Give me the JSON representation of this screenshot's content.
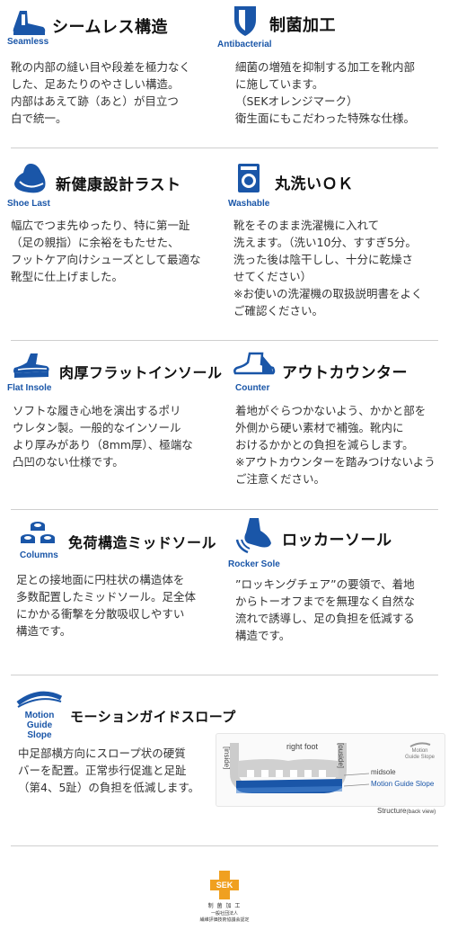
{
  "features": [
    {
      "id": "seamless",
      "title": "シームレス構造",
      "subtitle": "Seamless",
      "icon": "shoe-icon",
      "body": "靴の内部の縫い目や段差を極力なく\nした、足あたりのやさしい構造。\n内部はあえて跡（あと）が目立つ\n白で統一。"
    },
    {
      "id": "antibacterial",
      "title": "制菌加工",
      "subtitle": "Antibacterial",
      "icon": "shield-icon",
      "body": "細菌の増殖を抑制する加工を靴内部\nに施しています。\n（SEKオレンジマーク）\n衛生面にもこだわった特殊な仕様。"
    },
    {
      "id": "shoe-last",
      "title": "新健康設計ラスト",
      "subtitle": "Shoe Last",
      "icon": "shoe-last-icon",
      "body": "幅広でつま先ゆったり、特に第一趾\n（足の親指）に余裕をもたせた、\nフットケア向けシューズとして最適な\n靴型に仕上げました。"
    },
    {
      "id": "washable",
      "title": "丸洗いＯＫ",
      "subtitle": "Washable",
      "icon": "washing-machine-icon",
      "body": "靴をそのまま洗濯機に入れて\n洗えます。（洗い10分、すすぎ5分。\n洗った後は陰干しし、十分に乾燥さ\nせてください）\n※お使いの洗濯機の取扱説明書をよく\nご確認ください。"
    },
    {
      "id": "flat-insole",
      "title": "肉厚フラットインソール",
      "subtitle": "Flat Insole",
      "icon": "insole-icon",
      "body": "ソフトな履き心地を演出するポリ\nウレタン製。一般的なインソール\nより厚みがあり（8mm厚）、極端な\n凸凹のない仕様です。"
    },
    {
      "id": "counter",
      "title": "アウトカウンター",
      "subtitle": "Counter",
      "icon": "counter-icon",
      "body": "着地がぐらつかないよう、かかと部を\n外側から硬い素材で補強。靴内に\nおけるかかとの負担を減らします。\n※アウトカウンターを踏みつけないよう\nご注意ください。"
    },
    {
      "id": "columns",
      "title": "免荷構造ミッドソール",
      "subtitle": "Columns",
      "icon": "columns-icon",
      "body": "足との接地面に円柱状の構造体を\n多数配置したミッドソール。足全体\nにかかる衝撃を分散吸収しやすい\n構造です。"
    },
    {
      "id": "rocker-sole",
      "title": "ロッカーソール",
      "subtitle": "Rocker Sole",
      "icon": "rocker-sole-icon",
      "body": "”ロッキングチェア”の要領で、着地\nからトーオフまでを無理なく自然な\n流れで誘導し、足の負担を低減する\n構造です。"
    },
    {
      "id": "motion-guide-slope",
      "title": "モーションガイドスロープ",
      "subtitle": "Motion\nGuide Slope",
      "icon": "motion-guide-slope-icon",
      "body": "中足部横方向にスロープ状の硬質\nバーを配置。正常歩行促進と足趾\n（第4、5趾）の負担を低減します。"
    }
  ],
  "diagram": {
    "right_foot": "right foot",
    "inside": "[inside]",
    "outside": "[ouside]",
    "midsole": "midsole",
    "mgs": "Motion Guide Slope",
    "badge_line1": "Motion",
    "badge_line2": "Guide Slope",
    "caption_main": "Structure",
    "caption_sub": "(back view)"
  },
  "sek": {
    "mark": "SEK",
    "line1": "制 菌 加 工",
    "line2": "一般社団法人",
    "line3": "繊維評価技術協議会認定"
  },
  "colors": {
    "accent": "#1a56a8",
    "sek_orange": "#f0a020",
    "divider": "#cfcfcf"
  }
}
